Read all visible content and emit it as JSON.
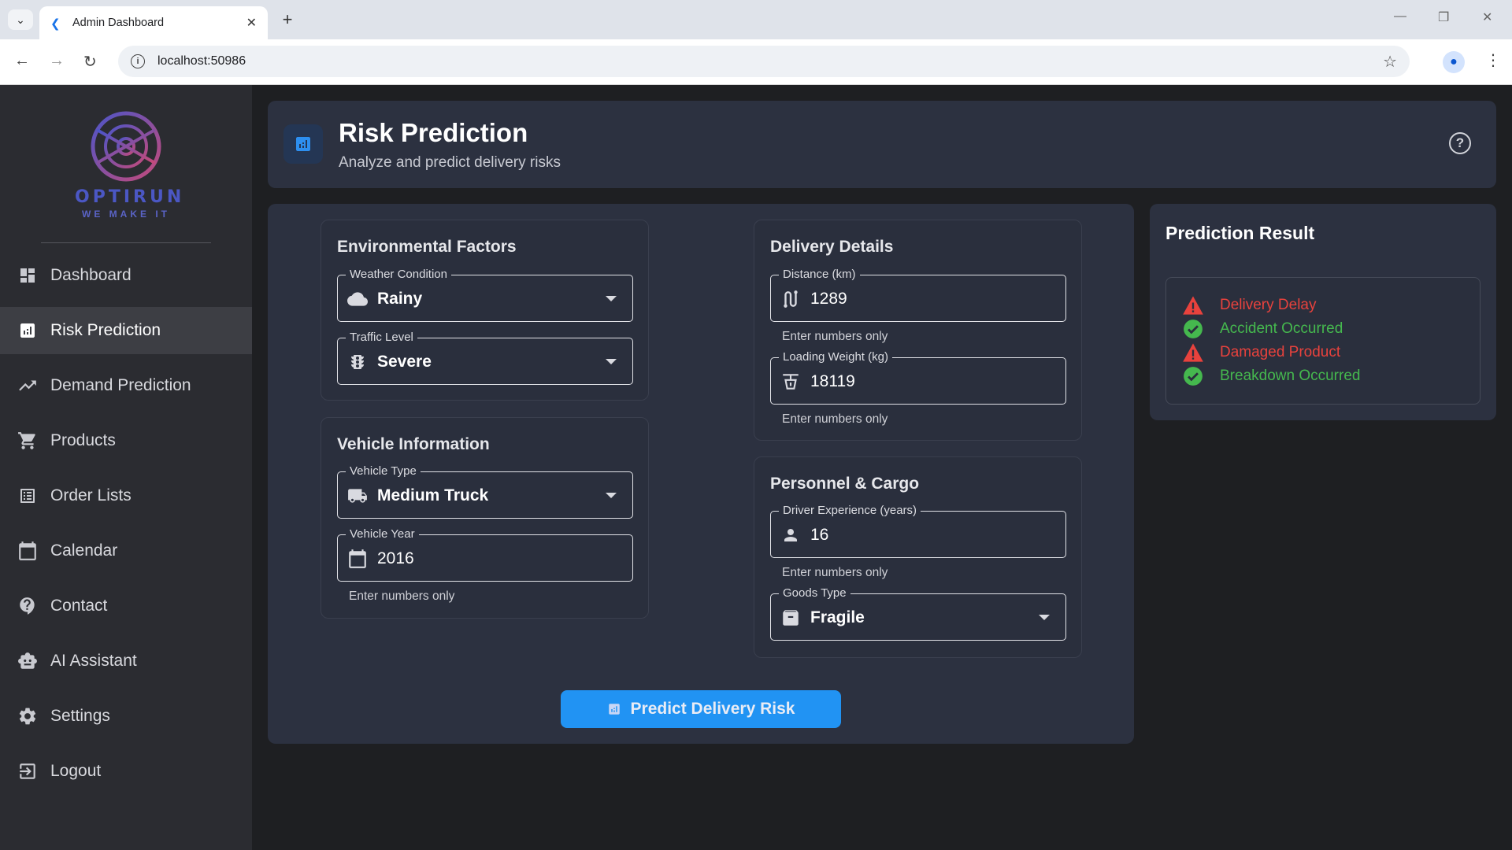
{
  "browser": {
    "tab_title": "Admin Dashboard",
    "url": "localhost:50986"
  },
  "brand": {
    "name": "OPTIRUN",
    "tagline": "WE MAKE IT"
  },
  "sidebar": {
    "items": [
      {
        "label": "Dashboard",
        "icon": "dashboard-icon"
      },
      {
        "label": "Risk Prediction",
        "icon": "analytics-icon",
        "active": true
      },
      {
        "label": "Demand Prediction",
        "icon": "trending-up-icon"
      },
      {
        "label": "Products",
        "icon": "cart-icon"
      },
      {
        "label": "Order Lists",
        "icon": "list-icon"
      },
      {
        "label": "Calendar",
        "icon": "calendar-icon"
      },
      {
        "label": "Contact",
        "icon": "help-bubble-icon"
      },
      {
        "label": "AI Assistant",
        "icon": "robot-icon"
      },
      {
        "label": "Settings",
        "icon": "gear-icon"
      },
      {
        "label": "Logout",
        "icon": "logout-icon"
      }
    ]
  },
  "header": {
    "title": "Risk Prediction",
    "subtitle": "Analyze and predict delivery risks"
  },
  "environmental": {
    "title": "Environmental Factors",
    "weather_label": "Weather Condition",
    "weather_value": "Rainy",
    "traffic_label": "Traffic Level",
    "traffic_value": "Severe"
  },
  "vehicle": {
    "title": "Vehicle Information",
    "type_label": "Vehicle Type",
    "type_value": "Medium Truck",
    "year_label": "Vehicle Year",
    "year_value": "2016",
    "year_helper": "Enter numbers only"
  },
  "delivery": {
    "title": "Delivery Details",
    "distance_label": "Distance (km)",
    "distance_value": "1289",
    "distance_helper": "Enter numbers only",
    "weight_label": "Loading Weight (kg)",
    "weight_value": "18119",
    "weight_helper": "Enter numbers only"
  },
  "personnel": {
    "title": "Personnel & Cargo",
    "experience_label": "Driver Experience (years)",
    "experience_value": "16",
    "experience_helper": "Enter numbers only",
    "goods_label": "Goods Type",
    "goods_value": "Fragile"
  },
  "predict_button": "Predict Delivery Risk",
  "result": {
    "title": "Prediction Result",
    "items": [
      {
        "label": "Delivery Delay",
        "status": "risk"
      },
      {
        "label": "Accident Occurred",
        "status": "ok"
      },
      {
        "label": "Damaged Product",
        "status": "risk"
      },
      {
        "label": "Breakdown Occurred",
        "status": "ok"
      }
    ]
  },
  "colors": {
    "accent": "#2193f3",
    "risk": "#e8423d",
    "ok": "#45b84e",
    "brand": "#4b57c4"
  }
}
